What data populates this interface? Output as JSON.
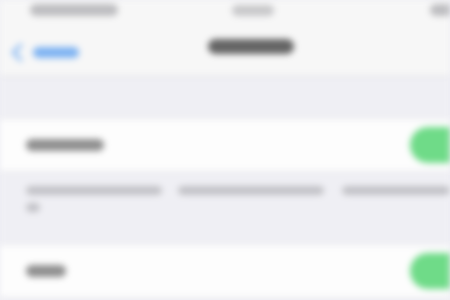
{
  "screen": {
    "status_bar": {
      "carrier": "",
      "time": "",
      "battery": ""
    },
    "nav_bar": {
      "back_label": "",
      "title": ""
    },
    "settings": [
      {
        "label": "",
        "toggle_on": true,
        "footer": ""
      },
      {
        "label": "",
        "toggle_on": true
      }
    ],
    "colors": {
      "background": "#efeff4",
      "cell": "#fdfdfd",
      "accent": "#7eb3f2",
      "toggle_on": "#6fdb88"
    }
  }
}
